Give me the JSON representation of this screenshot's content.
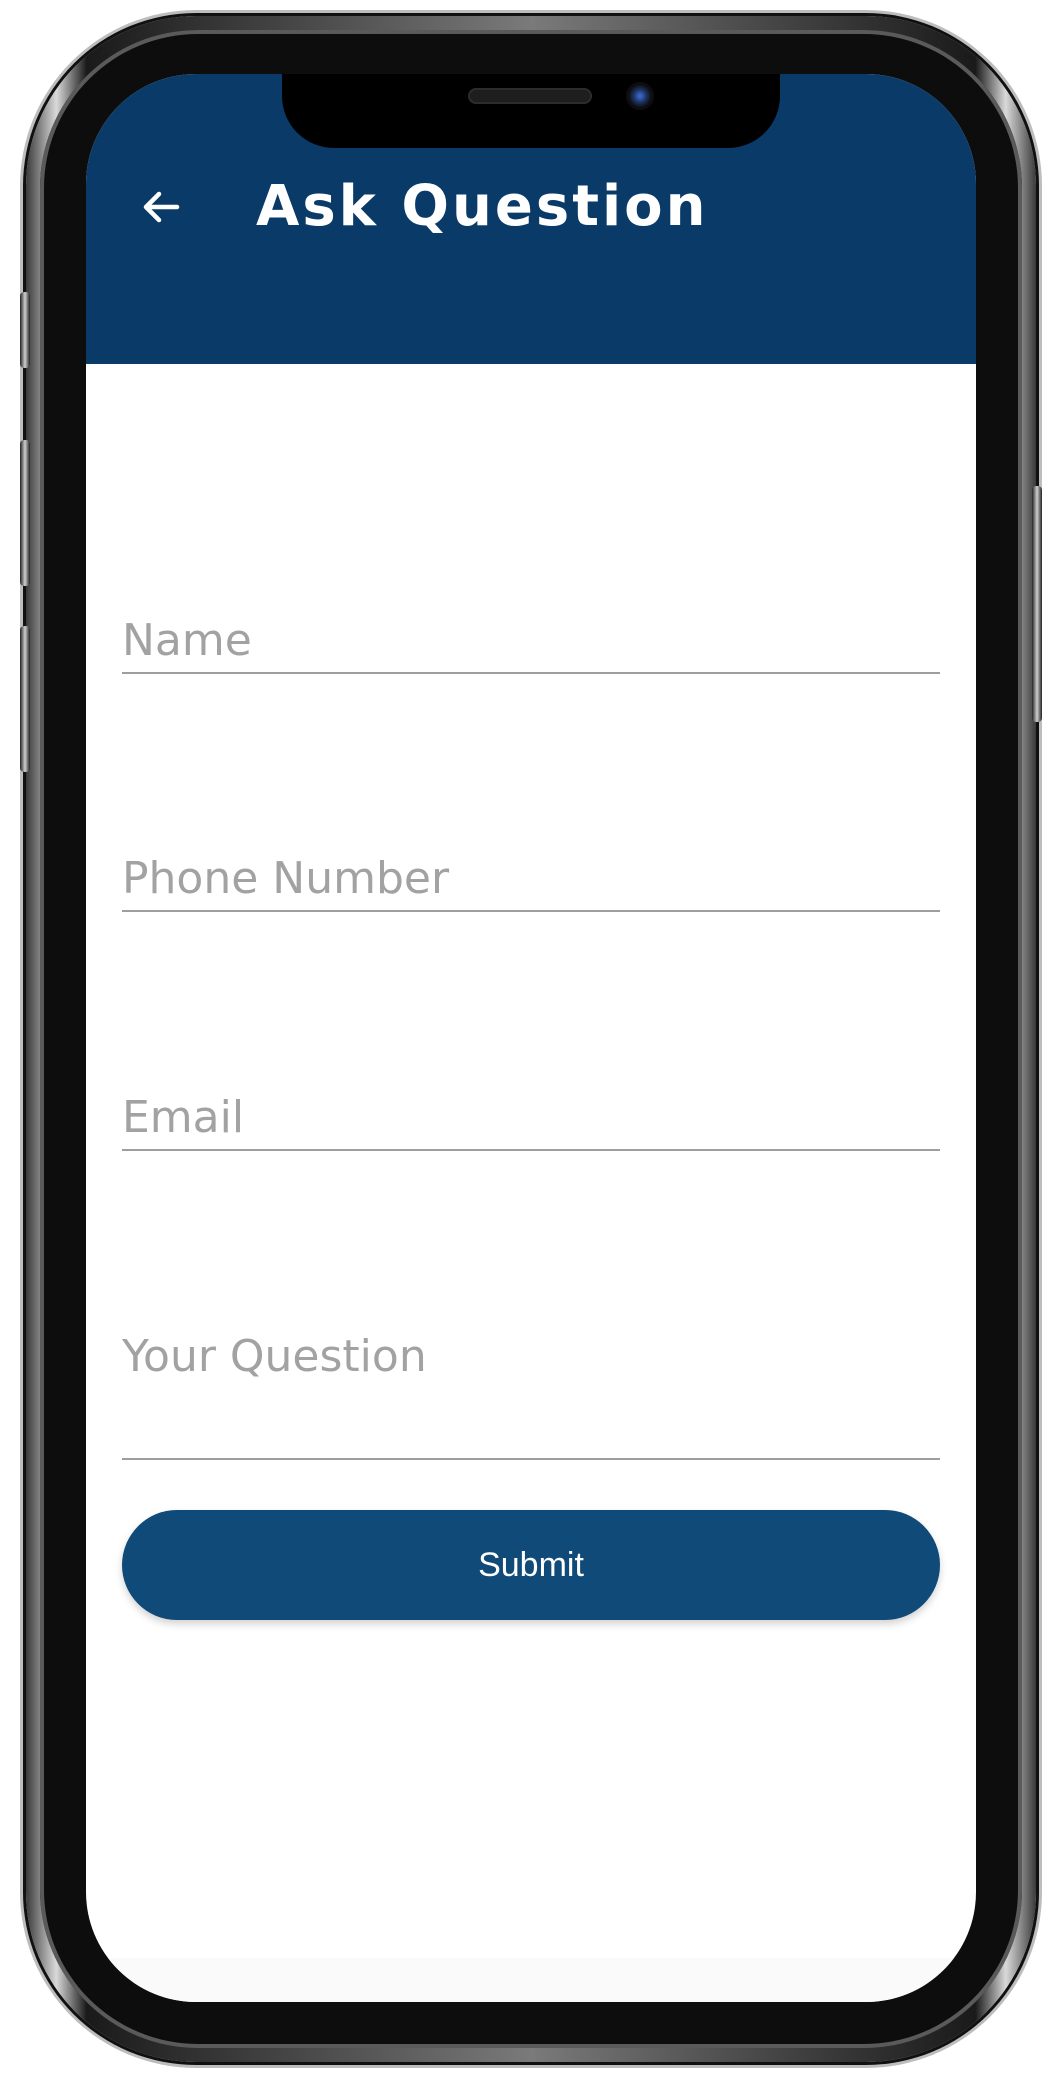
{
  "colors": {
    "brand": "#0a3a68",
    "button": "#0f4a78",
    "placeholder": "#a2a2a2",
    "underline": "#9e9e9e"
  },
  "header": {
    "back_icon": "arrow-left-icon",
    "title": "Ask Question"
  },
  "form": {
    "name": {
      "placeholder": "Name",
      "value": ""
    },
    "phone": {
      "placeholder": "Phone Number",
      "value": ""
    },
    "email": {
      "placeholder": "Email",
      "value": ""
    },
    "question": {
      "placeholder": "Your Question",
      "value": ""
    },
    "submit_label": "Submit"
  }
}
